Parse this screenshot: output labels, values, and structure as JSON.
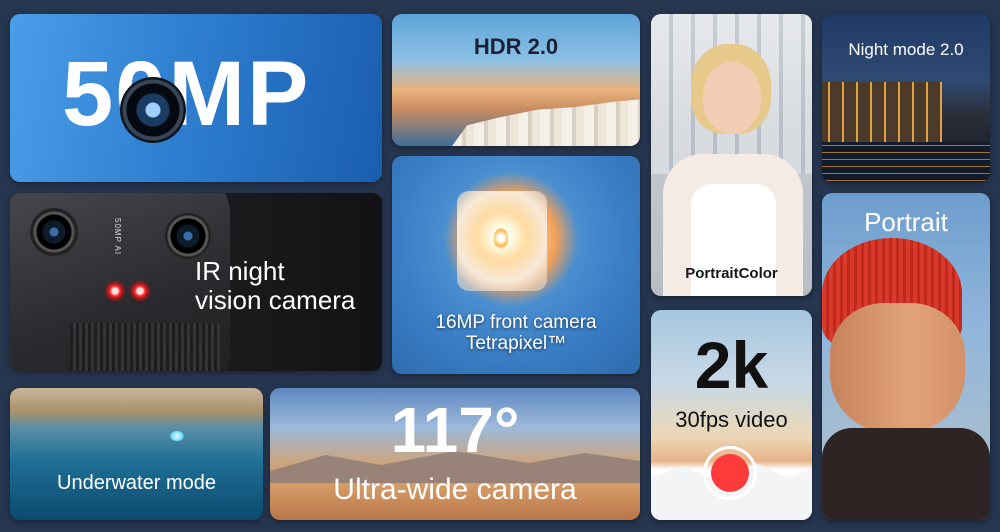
{
  "tiles": {
    "megapixel": {
      "headline": "50MP"
    },
    "ir_night": {
      "line1": "IR night",
      "line2": "vision camera",
      "phone_label": "50MP AI"
    },
    "underwater": {
      "label": "Underwater mode"
    },
    "hdr": {
      "label": "HDR 2.0"
    },
    "front_camera": {
      "line1": "16MP front camera",
      "line2": "Tetrapixel™"
    },
    "ultra_wide": {
      "headline": "117°",
      "label": "Ultra-wide camera"
    },
    "portrait_color": {
      "label": "PortraitColor"
    },
    "video": {
      "headline": "2k",
      "label": "30fps video"
    },
    "night_mode": {
      "label": "Night mode 2.0"
    },
    "portrait": {
      "label": "Portrait"
    }
  },
  "colors": {
    "background": "#26364f",
    "megapixel_tile": "#2f7fd0",
    "record_button": "#ff3a3a"
  },
  "icons": [
    "camera-lens-icon",
    "record-button-icon"
  ]
}
